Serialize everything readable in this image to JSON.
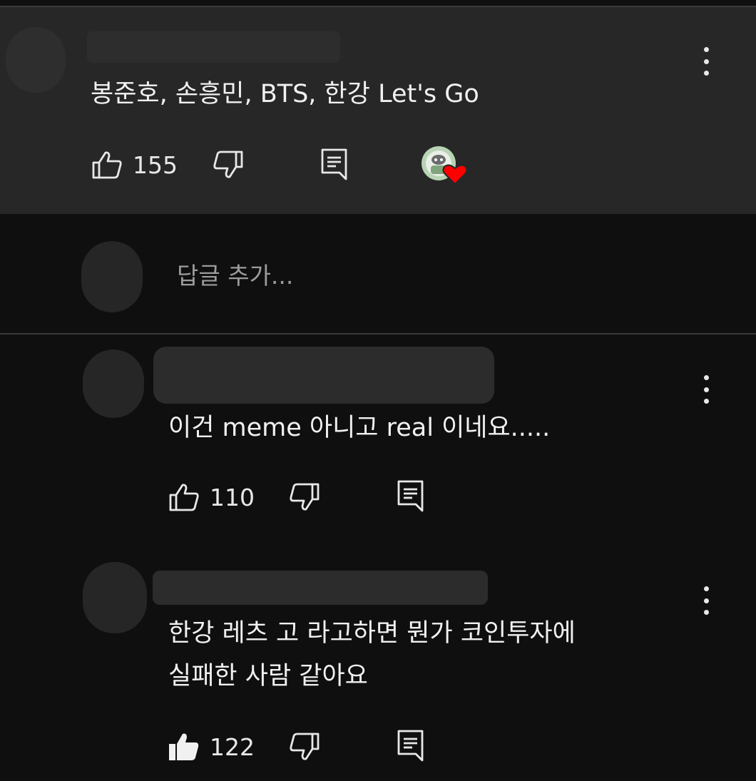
{
  "highlighted_comment": {
    "text": "봉준호, 손흥민, BTS, 한강 Let's Go",
    "likes": "155",
    "creator_heart": true
  },
  "reply_box": {
    "placeholder": "답글 추가..."
  },
  "replies": [
    {
      "text": "이건 meme 아니고 real 이네요.....",
      "likes": "110",
      "liked": false
    },
    {
      "text_line1": "한강 레츠 고 라고하면 뭔가 코인투자에",
      "text_line2": "실패한 사람 같아요",
      "likes": "122",
      "liked": true
    }
  ],
  "icons": {
    "like": "thumbs-up-icon",
    "dislike": "thumbs-down-icon",
    "reply": "reply-icon",
    "more": "more-vert-icon",
    "heart": "heart-icon"
  },
  "colors": {
    "background": "#0f0f0f",
    "highlight_bg": "#272727",
    "heart": "#ff0000",
    "text": "#f1f1f1",
    "placeholder": "#9c9c9c"
  }
}
